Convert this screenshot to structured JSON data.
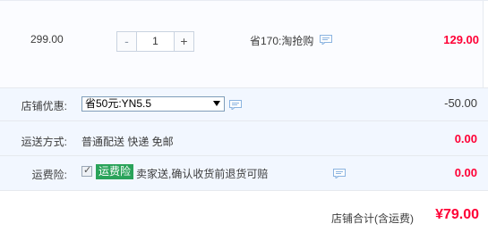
{
  "item": {
    "price": "299.00",
    "quantity": "1",
    "minus_label": "-",
    "plus_label": "+",
    "promo_text": "省170:淘抢购",
    "subtotal": "129.00"
  },
  "store_discount": {
    "label": "店铺优惠:",
    "selected_option": "省50元:YN5.5",
    "value": "-50.00"
  },
  "shipping": {
    "label": "运送方式:",
    "method": "普通配送 快递 免邮",
    "value": "0.00"
  },
  "insurance": {
    "label": "运费险:",
    "badge": "运费险",
    "description": "卖家送,确认收货前退货可赔",
    "value": "0.00"
  },
  "total": {
    "label": "店铺合计(含运费)",
    "value": "¥79.00"
  },
  "colors": {
    "price_red": "#ff0036",
    "badge_green": "#2aa35a",
    "row_bg": "#f2f7ff"
  },
  "icons": [
    "chat-icon",
    "dropdown-arrow-icon",
    "checkbox-tick-icon"
  ]
}
